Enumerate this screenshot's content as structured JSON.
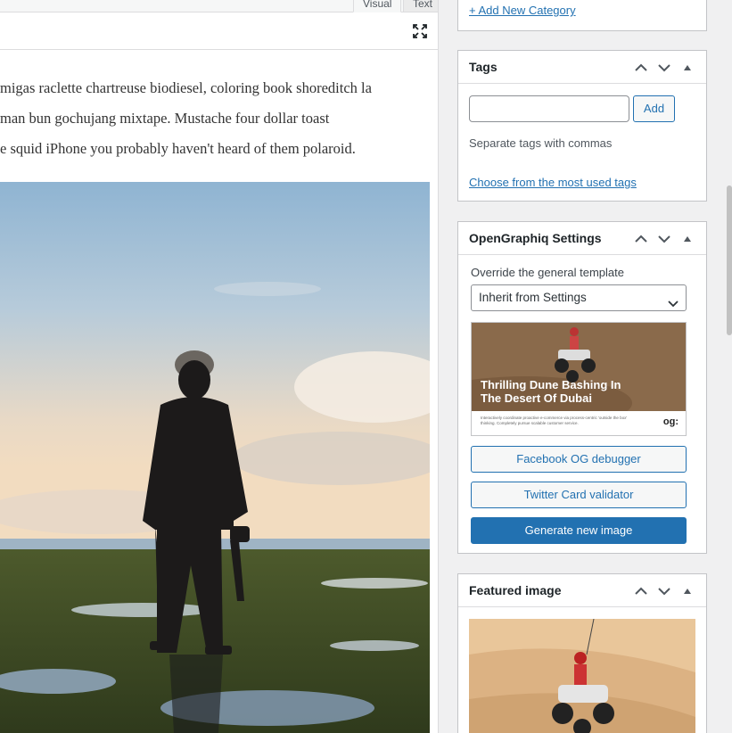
{
  "editor": {
    "tabs": [
      {
        "label": "Visual"
      },
      {
        "label": "Text"
      }
    ],
    "content_lines": [
      "migas raclette chartreuse biodiesel, coloring book shoreditch la",
      "man bun gochujang mixtape. Mustache four dollar toast",
      "e squid iPhone you probably haven't heard of them polaroid."
    ]
  },
  "categories": {
    "add_link": "+ Add New Category"
  },
  "tags": {
    "title": "Tags",
    "input_value": "",
    "add_label": "Add",
    "hint": "Separate tags with commas",
    "most_used_link": "Choose from the most used tags"
  },
  "opengraphiq": {
    "title": "OpenGraphiq Settings",
    "override_label": "Override the general template",
    "select_value": "Inherit from Settings",
    "preview_headline_1": "Thrilling Dune Bashing In",
    "preview_headline_2": "The Desert Of Dubai",
    "preview_small_text": "Interactively coordinate proactive e-commerce via process-centric 'outside the box' thinking. Completely pursue scalable customer service.",
    "preview_logo": "og:",
    "facebook_btn": "Facebook OG debugger",
    "twitter_btn": "Twitter Card validator",
    "generate_btn": "Generate new image"
  },
  "featured": {
    "title": "Featured image"
  },
  "colors": {
    "accent": "#2271b1",
    "border": "#c3c4c7",
    "background": "#f0f0f1"
  }
}
